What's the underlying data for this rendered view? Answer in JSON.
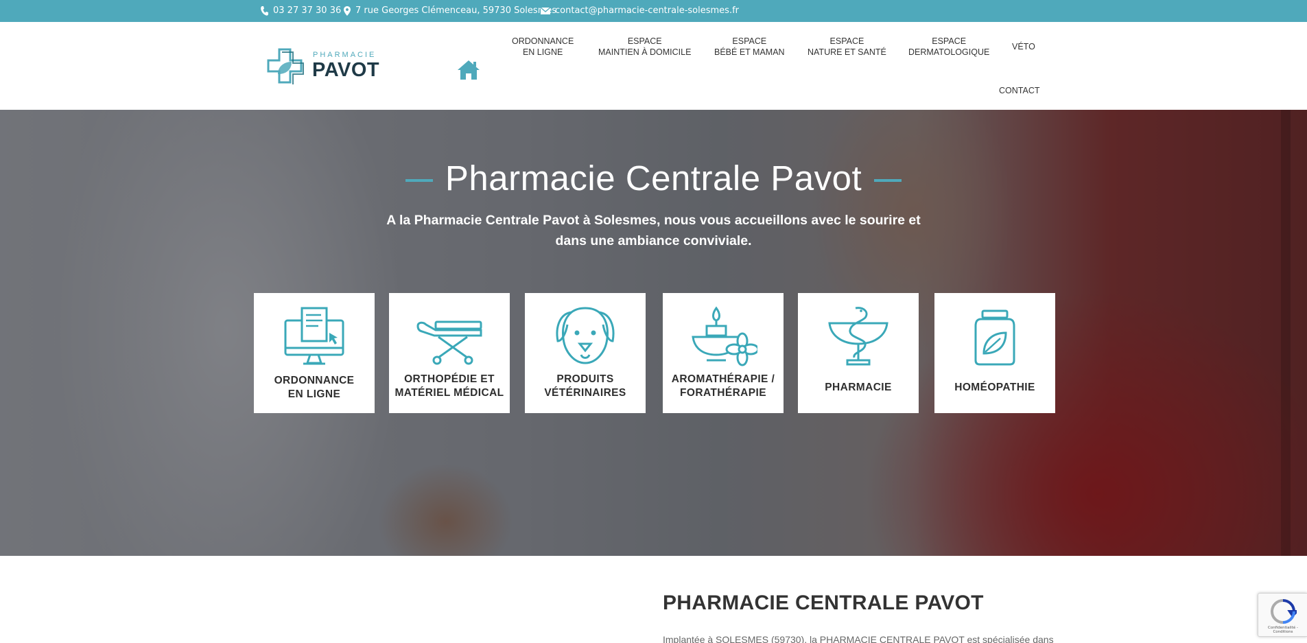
{
  "topbar": {
    "phone": "03 27 37 30 36",
    "address": "7 rue Georges Clémenceau, 59730 Solesmes",
    "email": "contact@pharmacie-centrale-solesmes.fr"
  },
  "logo": {
    "small": "PHARMACIE",
    "big": "PAVOT"
  },
  "nav": {
    "home_icon": "home-icon",
    "items": [
      {
        "line1": "ORDONNANCE",
        "line2": "EN LIGNE"
      },
      {
        "line1": "ESPACE",
        "line2": "MAINTIEN À DOMICILE"
      },
      {
        "line1": "ESPACE",
        "line2": "BÉBÉ ET MAMAN"
      },
      {
        "line1": "ESPACE",
        "line2": "NATURE ET SANTÉ"
      },
      {
        "line1": "ESPACE",
        "line2": "DERMATOLOGIQUE"
      },
      {
        "line1": "VÉTO"
      },
      {
        "line1": "CONTACT"
      }
    ]
  },
  "hero": {
    "title": "Pharmacie Centrale Pavot",
    "subtitle": "A la Pharmacie Centrale Pavot à Solesmes, nous vous accueillons avec le sourire et dans une ambiance conviviale.",
    "cards": [
      {
        "icon": "prescription-computer-icon",
        "line1": "ORDONNANCE",
        "line2": "EN LIGNE"
      },
      {
        "icon": "medical-stretcher-icon",
        "line1": "ORTHOPÉDIE ET",
        "line2": "MATÉRIEL MÉDICAL"
      },
      {
        "icon": "dog-icon",
        "line1": "PRODUITS",
        "line2": "VÉTÉRINAIRES"
      },
      {
        "icon": "candle-flower-icon",
        "line1": "AROMATHÉRAPIE /",
        "line2": "FORATHÉRAPIE"
      },
      {
        "icon": "caduceus-icon",
        "line1": "PHARMACIE"
      },
      {
        "icon": "remedy-jar-icon",
        "line1": "HOMÉOPATHIE"
      }
    ]
  },
  "content": {
    "title": "PHARMACIE CENTRALE PAVOT",
    "text": "Implantée à SOLESMES (59730), la PHARMACIE CENTRALE PAVOT est spécialisée dans"
  },
  "recaptcha": {
    "label": "Confidentialité - Conditions"
  },
  "colors": {
    "accent": "#4fa9bb",
    "dark": "#1f3a47"
  }
}
